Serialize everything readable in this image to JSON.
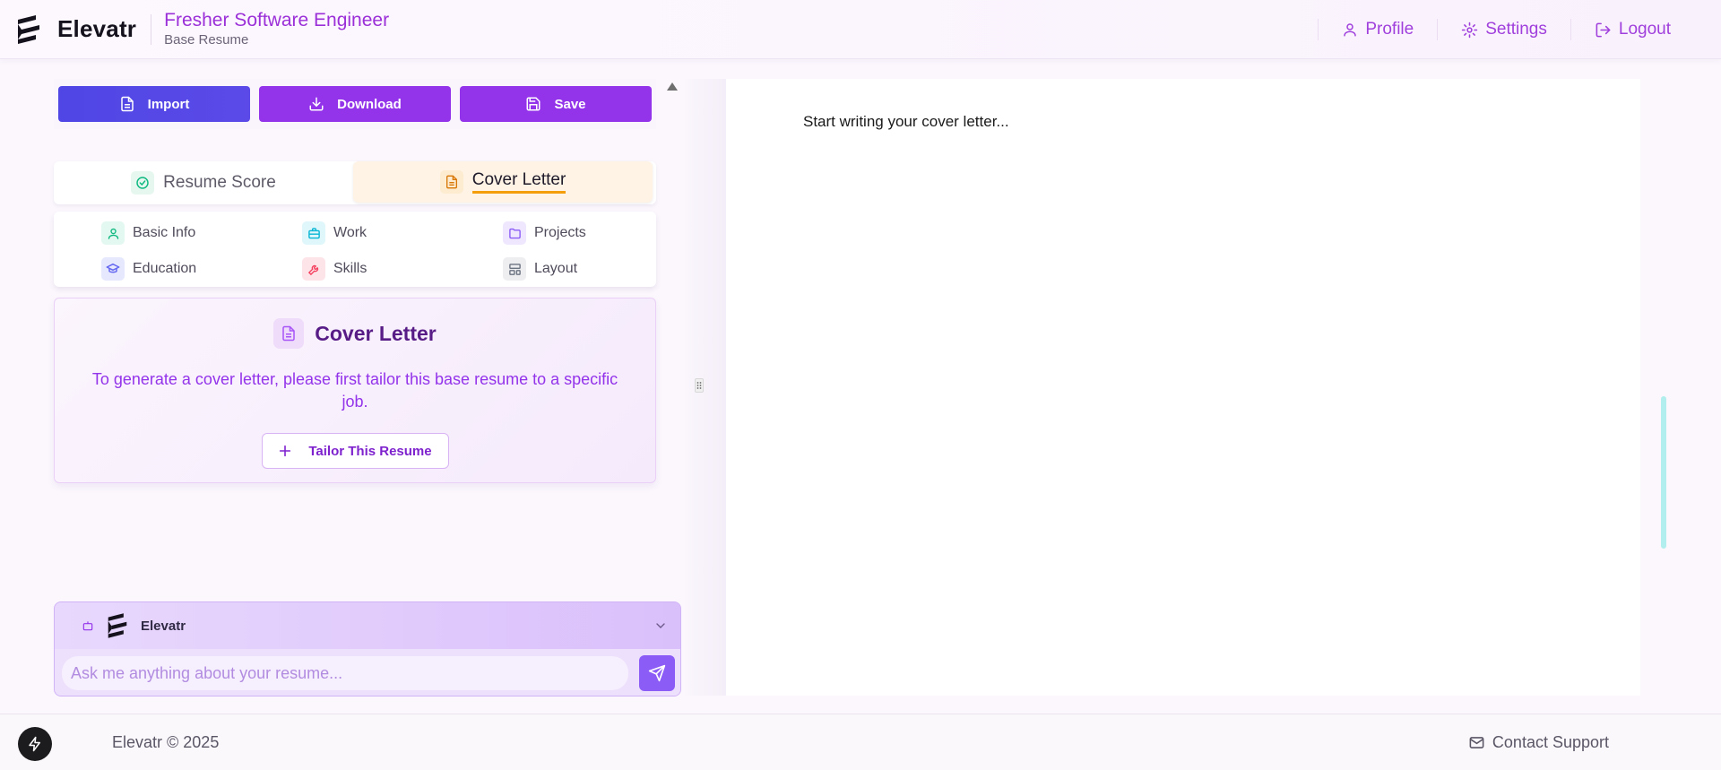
{
  "header": {
    "brand": "Elevatr",
    "doc_title": "Fresher Software Engineer",
    "doc_subtitle": "Base Resume",
    "nav": [
      {
        "label": "Profile",
        "icon": "user-icon"
      },
      {
        "label": "Settings",
        "icon": "gear-icon"
      },
      {
        "label": "Logout",
        "icon": "logout-icon"
      }
    ]
  },
  "toolbar": {
    "import_label": "Import",
    "download_label": "Download",
    "save_label": "Save"
  },
  "tabs": [
    {
      "label": "Resume Score",
      "active": false
    },
    {
      "label": "Cover Letter",
      "active": true
    }
  ],
  "sections": [
    {
      "label": "Basic Info",
      "icon": "user-icon",
      "color": "#10b981"
    },
    {
      "label": "Work",
      "icon": "briefcase-icon",
      "color": "#06b6d4"
    },
    {
      "label": "Projects",
      "icon": "folder-icon",
      "color": "#8b5cf6"
    },
    {
      "label": "Education",
      "icon": "graduation-cap-icon",
      "color": "#6366f1"
    },
    {
      "label": "Skills",
      "icon": "wrench-icon",
      "color": "#f43f5e"
    },
    {
      "label": "Layout",
      "icon": "layout-icon",
      "color": "#6b7280"
    }
  ],
  "cover_letter_card": {
    "title": "Cover Letter",
    "message": "To generate a cover letter, please first tailor this base resume to a specific job.",
    "button_label": "Tailor This Resume"
  },
  "assistant": {
    "name": "Elevatr",
    "placeholder": "Ask me anything about your resume..."
  },
  "editor": {
    "placeholder_text": "Start writing your cover letter..."
  },
  "footer": {
    "copyright": "Elevatr © 2025",
    "support_label": "Contact Support"
  },
  "colors": {
    "accent": "#9333ea",
    "import_button": "#4f46e5",
    "active_tab_underline": "#f59e0b"
  }
}
